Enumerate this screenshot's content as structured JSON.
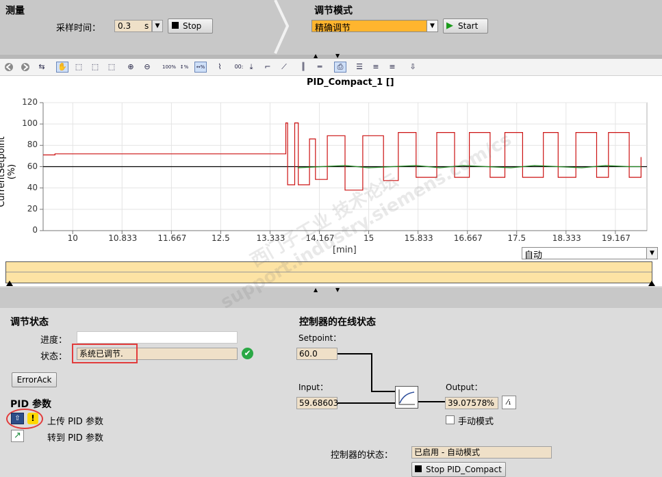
{
  "measure": {
    "title": "测量",
    "sample_time_label": "采样时间：",
    "sample_time_value": "0.3",
    "sample_time_unit": "s",
    "stop_label": "Stop"
  },
  "tuning_mode": {
    "title": "调节模式",
    "selected": "精确调节",
    "start_label": "Start"
  },
  "toolbar": {
    "icons": [
      "back-icon",
      "forward-icon",
      "reset-zoom-icon",
      "pan-hand-icon",
      "zoom-box-icon",
      "zoom-x-icon",
      "zoom-y-icon",
      "zoom-in-icon",
      "zoom-out-icon",
      "zoom-100-icon",
      "zoom-y-100-icon",
      "zoom-x-100-icon",
      "auto-scale-icon",
      "step-icon",
      "fit-icon",
      "line-icon",
      "cursor-v-icon",
      "cursor-h-icon",
      "snapshot-icon",
      "legend-icon",
      "align-left-icon",
      "align-right-icon",
      "export-icon"
    ]
  },
  "chart_data": {
    "type": "line",
    "title": "PID_Compact_1 []",
    "ylabel": "CurrentSetpoint (%)",
    "xlabel": "[min]",
    "ylim": [
      0,
      120
    ],
    "yticks": [
      "120",
      "100",
      "80",
      "60",
      "40",
      "20",
      "0"
    ],
    "xlim": [
      9.5,
      19.7
    ],
    "xticks": [
      "10",
      "10.833",
      "11.667",
      "12.5",
      "13.333",
      "14.167",
      "15",
      "15.833",
      "16.667",
      "17.5",
      "18.333",
      "19.167"
    ],
    "grid": true,
    "series": [
      {
        "color": "#000000",
        "x": [
          9.5,
          19.7
        ],
        "y": [
          60,
          60
        ]
      },
      {
        "color": "#cc1111",
        "x": [
          9.5,
          9.7,
          9.7,
          13.6,
          13.6,
          13.63,
          13.63,
          13.75,
          13.75,
          13.81,
          13.81,
          14.0,
          14.0,
          14.1,
          14.1,
          14.3,
          14.3,
          14.6,
          14.6,
          14.9,
          14.9,
          15.25,
          15.25,
          15.5,
          15.5,
          15.8,
          15.8,
          16.15,
          16.15,
          16.45,
          16.45,
          16.7,
          16.7,
          17.05,
          17.05,
          17.3,
          17.3,
          17.6,
          17.6,
          17.95,
          17.95,
          18.2,
          18.2,
          18.5,
          18.5,
          18.85,
          18.85,
          19.05,
          19.05,
          19.4,
          19.4,
          19.6,
          19.6
        ],
        "y": [
          71,
          71,
          72,
          72,
          101,
          101,
          43,
          43,
          101,
          101,
          43,
          43,
          86,
          86,
          48,
          48,
          89,
          89,
          38,
          38,
          89,
          89,
          47,
          47,
          92,
          92,
          50,
          50,
          92,
          92,
          50,
          50,
          92,
          92,
          50,
          50,
          92,
          92,
          50,
          50,
          92,
          92,
          50,
          50,
          92,
          92,
          50,
          50,
          92,
          92,
          50,
          50,
          69
        ]
      },
      {
        "color": "#228822",
        "x": [
          13.8,
          14.2,
          14.6,
          15.0,
          15.4,
          15.8,
          16.2,
          16.6,
          17.0,
          17.4,
          17.8,
          18.2,
          18.6,
          19.0,
          19.4,
          19.6
        ],
        "y": [
          59,
          60,
          61,
          59,
          60,
          61,
          59,
          61,
          60,
          59,
          61,
          60,
          59,
          61,
          60,
          60
        ]
      }
    ]
  },
  "axis_mode": {
    "selected": "自动"
  },
  "tuning_status": {
    "title": "调节状态",
    "progress_label": "进度：",
    "progress_value": "",
    "status_label": "状态：",
    "status_value": "系统已调节.",
    "error_ack_label": "ErrorAck"
  },
  "pid_params": {
    "title": "PID 参数",
    "upload_label": "上传 PID 参数",
    "goto_label": "转到 PID 参数"
  },
  "online_status": {
    "title": "控制器的在线状态",
    "setpoint_label": "Setpoint：",
    "setpoint_value": "60.0",
    "input_label": "Input：",
    "input_value": "59.68603",
    "output_label": "Output：",
    "output_value": "39.07578",
    "output_unit": "%",
    "manual_mode_label": "手动模式",
    "controller_state_label": "控制器的状态：",
    "controller_state_value": "已启用 - 自动模式",
    "stop_pid_label": "Stop PID_Compact"
  },
  "watermark": "西门子工业 技术论坛 support.industry.siemens.com/cs"
}
